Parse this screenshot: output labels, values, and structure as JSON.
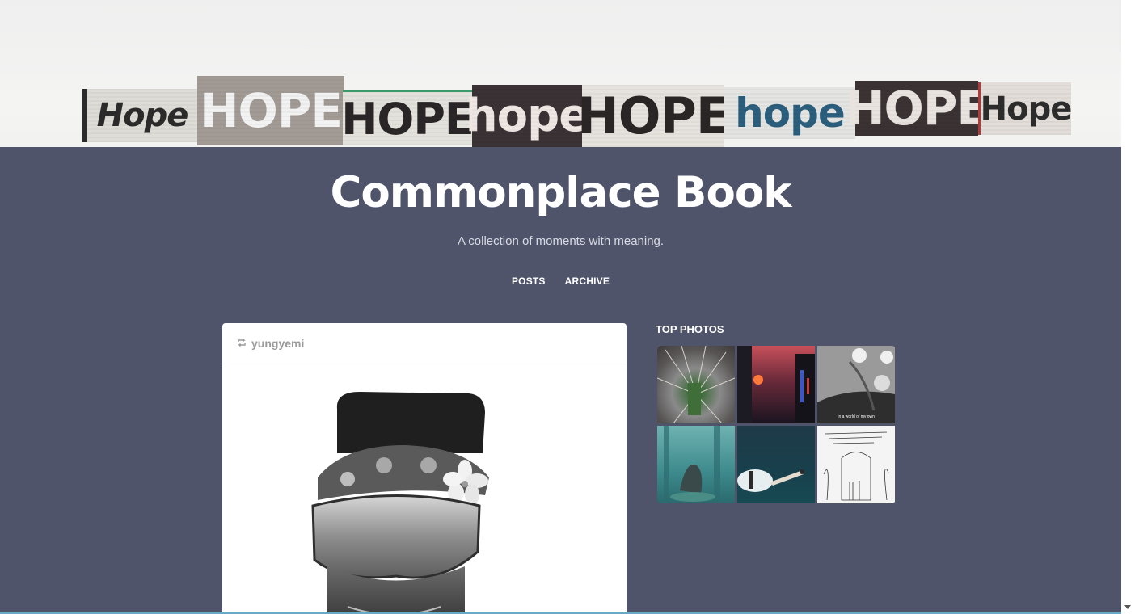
{
  "banner": {
    "clippings": [
      {
        "text": "Hope",
        "color": "#2b2b2b",
        "bg": "#dedcd6"
      },
      {
        "text": "HOPE",
        "color": "#f2f2f2",
        "bg": "#a19a95"
      },
      {
        "text": "HOPE",
        "color": "#2a2526",
        "bg": "#e3e1dc"
      },
      {
        "text": "hope",
        "color": "#efe7e4",
        "bg": "#3a3234"
      },
      {
        "text": "HOPE",
        "color": "#2b2626",
        "bg": "#e6e3de"
      },
      {
        "text": "hope",
        "color": "#2b5f7d",
        "bg": "#e4e4e2"
      },
      {
        "text": "HOPE",
        "color": "#e9e3df",
        "bg": "#3b3234"
      },
      {
        "text": "Hope",
        "color": "#2c2c2c",
        "bg": "#e2ddd8"
      }
    ]
  },
  "site": {
    "title": "Commonplace Book",
    "description": "A collection of moments with meaning."
  },
  "nav": {
    "posts": "POSTS",
    "archive": "ARCHIVE"
  },
  "post": {
    "reblog_icon": "reblog-icon",
    "username": "yungyemi"
  },
  "sidebar": {
    "top_photos_title": "TOP PHOTOS",
    "photos": [
      {
        "icon": "photo-thumbnail",
        "caption": ""
      },
      {
        "icon": "photo-thumbnail",
        "caption": ""
      },
      {
        "icon": "photo-thumbnail",
        "caption": "In a world of my own"
      },
      {
        "icon": "photo-thumbnail",
        "caption": ""
      },
      {
        "icon": "photo-thumbnail",
        "caption": ""
      },
      {
        "icon": "photo-thumbnail",
        "caption": ""
      }
    ]
  },
  "colors": {
    "main_bg": "#4f546b",
    "card_bg": "#ffffff",
    "text_light": "#ffffff"
  }
}
